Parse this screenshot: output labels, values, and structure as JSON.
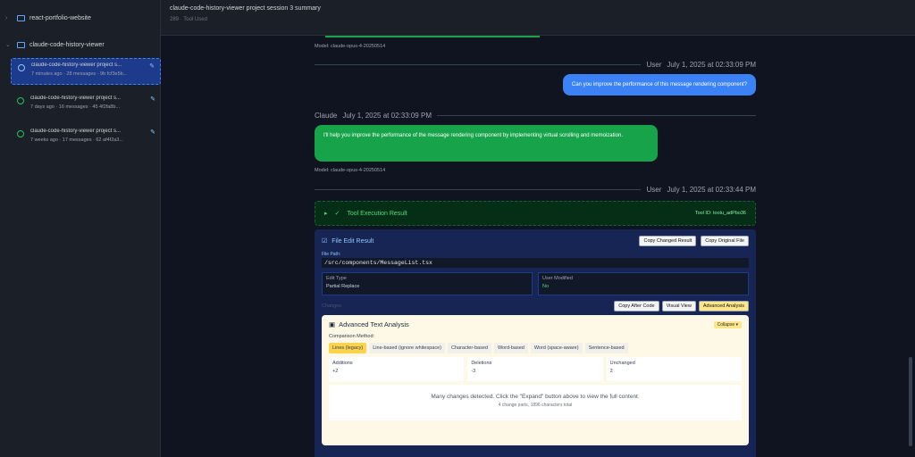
{
  "sidebar": {
    "projects": [
      {
        "name": "react-portfolio-website"
      },
      {
        "name": "claude-code-history-viewer"
      }
    ],
    "sessions": [
      {
        "title": "claude-code-history-viewer project s...",
        "meta": "7 minutes ago · 28 messages · 9b fcf3e5b..."
      },
      {
        "title": "claude-code-history-viewer project s...",
        "meta": "7 days ago · 16 messages · 45 4f2fa8b..."
      },
      {
        "title": "claude-code-history-viewer project s...",
        "meta": "7 weeks ago · 17 messages · 62 af4f2a3..."
      }
    ]
  },
  "header": {
    "title": "claude-code-history-viewer project session 3 summary",
    "subtitle": "289 · Tool Used"
  },
  "messages": {
    "model_top": "Model: claude-opus-4-20250514",
    "user1": {
      "sender": "User",
      "time": "July 1, 2025 at 02:33:09 PM",
      "text": "Can you improve the performance of this message rendering component?"
    },
    "claude1": {
      "sender": "Claude",
      "time": "July 1, 2025 at 02:33:09 PM",
      "text": "I'll help you improve the performance of the message rendering component by implementing virtual scrolling and memoization.",
      "model": "Model: claude-opus-4-20250514"
    },
    "user2": {
      "sender": "User",
      "time": "July 1, 2025 at 02:33:44 PM"
    }
  },
  "tool": {
    "title": "Tool Execution Result",
    "tool_id": "Tool ID: toolu_adPbo36"
  },
  "file_edit": {
    "title": "File Edit Result",
    "copy_changed": "Copy Changed Result",
    "copy_original": "Copy Original File",
    "path_label": "File Path:",
    "path": "/src/components/MessageList.tsx",
    "edit_type_label": "Edit Type",
    "edit_type": "Partial Replace",
    "user_modified_label": "User Modified",
    "user_modified": "No",
    "changes_label": "Changes",
    "copy_after": "Copy After Code",
    "visual_view": "Visual View",
    "advanced": "Advanced Analysis"
  },
  "analysis": {
    "title": "Advanced Text Analysis",
    "collapse": "Collapse ▾",
    "method_label": "Comparison Method:",
    "methods": [
      "Lines (legacy)",
      "Line-based (ignore whitespace)",
      "Character-based",
      "Word-based",
      "Word (space-aware)",
      "Sentence-based"
    ],
    "stats": [
      {
        "label": "Additions",
        "value": "+2"
      },
      {
        "label": "Deletions",
        "value": "-3"
      },
      {
        "label": "Unchanged",
        "value": "2"
      }
    ],
    "notice": "Many changes detected. Click the \"Expand\" button above to view the full content.",
    "notice_sub": "4 change parts, 1896 characters total"
  },
  "colors": {
    "user_bubble": "#3b82f6",
    "claude_bubble": "#16a34a",
    "selected": "#1e3a8a"
  }
}
